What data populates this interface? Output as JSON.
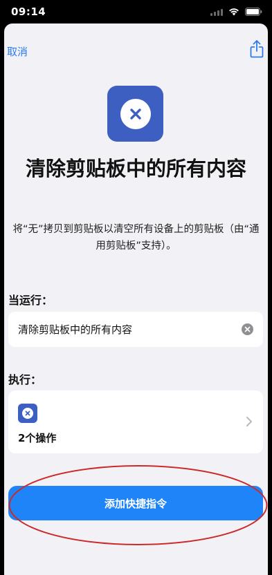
{
  "status_bar": {
    "time": "09:14",
    "icons": [
      "signal-icon",
      "wifi-icon",
      "battery-icon"
    ]
  },
  "nav": {
    "cancel_label": "取消",
    "share_icon": "share-icon"
  },
  "shortcut": {
    "icon": "clear-x-icon",
    "icon_color": "#3d5fc2",
    "title": "清除剪贴板中的所有内容",
    "description": "将“无”拷贝到剪贴板以清空所有设备上的剪贴板（由“通用剪贴板”支持）。"
  },
  "when_run": {
    "label": "当运行：",
    "value": "清除剪贴板中的所有内容"
  },
  "do": {
    "label": "执行：",
    "count_label": "2个操作"
  },
  "add_button": {
    "label": "添加快捷指令",
    "color": "#1f84f8"
  },
  "annotation": {
    "color": "#cc2a2a"
  }
}
